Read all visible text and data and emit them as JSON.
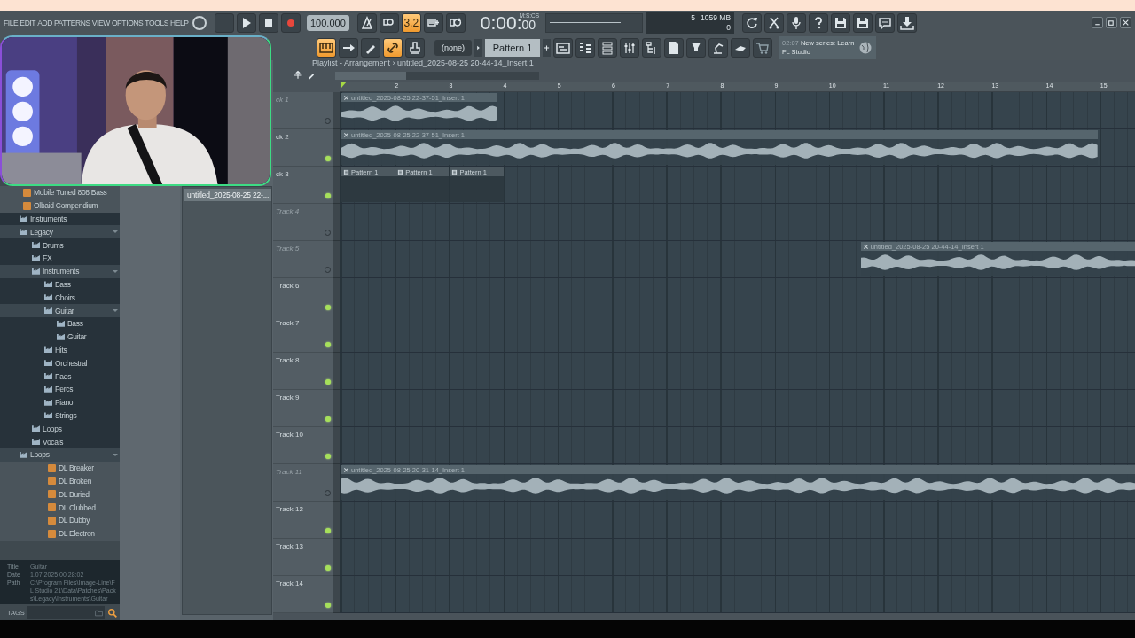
{
  "menu": [
    "FILE",
    "EDIT",
    "ADD",
    "PATTERNS",
    "VIEW",
    "OPTIONS",
    "TOOLS",
    "HELP"
  ],
  "transport": {
    "tempo": "100.000",
    "time": "0:00:",
    "time_cs": "00",
    "time_unit": "M:S:CS"
  },
  "toolbar_top": [
    {
      "on": false
    },
    {
      "on": false
    },
    {
      "on": true,
      "label": "3.2"
    },
    {
      "on": false
    },
    {
      "on": false
    }
  ],
  "monitor": {
    "voices": "5",
    "memory": "1059 MB",
    "cpu": "0"
  },
  "toolbar_second": [
    {
      "on": true
    },
    {
      "on": false
    },
    {
      "on": false
    },
    {
      "on": true
    },
    {
      "on": false
    }
  ],
  "pattern": {
    "channel": "(none)",
    "name": "Pattern 1"
  },
  "news": {
    "time": "02:07",
    "text": "New series: Learn FL Studio"
  },
  "browser": {
    "items": [
      {
        "label": "Mobile Tuned 808 Bass",
        "kind": "preset",
        "expanded": false
      },
      {
        "label": "Olbaid Compendium",
        "kind": "preset",
        "expanded": false
      },
      {
        "label": "Instruments",
        "kind": "folder",
        "expanded": false
      },
      {
        "label": "Legacy",
        "kind": "folder",
        "expanded": true,
        "children": [
          {
            "label": "Drums",
            "kind": "folder",
            "expanded": false
          },
          {
            "label": "FX",
            "kind": "folder",
            "expanded": false
          },
          {
            "label": "Instruments",
            "kind": "folder",
            "expanded": true,
            "children": [
              {
                "label": "Bass",
                "kind": "folder",
                "expanded": false
              },
              {
                "label": "Choirs",
                "kind": "folder",
                "expanded": false
              },
              {
                "label": "Guitar",
                "kind": "folder",
                "expanded": true,
                "children": [
                  {
                    "label": "Bass",
                    "kind": "folder",
                    "expanded": false
                  },
                  {
                    "label": "Guitar",
                    "kind": "folder",
                    "expanded": false
                  }
                ]
              },
              {
                "label": "Hits",
                "kind": "folder",
                "expanded": false
              },
              {
                "label": "Orchestral",
                "kind": "folder",
                "expanded": false
              },
              {
                "label": "Pads",
                "kind": "folder",
                "expanded": false
              },
              {
                "label": "Percs",
                "kind": "folder",
                "expanded": false
              },
              {
                "label": "Piano",
                "kind": "folder",
                "expanded": false
              },
              {
                "label": "Strings",
                "kind": "folder",
                "expanded": false
              }
            ]
          },
          {
            "label": "Loops",
            "kind": "folder",
            "expanded": false
          },
          {
            "label": "Vocals",
            "kind": "folder",
            "expanded": false
          }
        ]
      },
      {
        "label": "Loops",
        "kind": "folder",
        "expanded": true,
        "children": [
          {
            "label": "DL Breaker",
            "kind": "loop",
            "expanded": false
          },
          {
            "label": "DL Broken",
            "kind": "loop",
            "expanded": false
          },
          {
            "label": "DL Buried",
            "kind": "loop",
            "expanded": false
          },
          {
            "label": "DL Clubbed",
            "kind": "loop",
            "expanded": false
          },
          {
            "label": "DL Dubby",
            "kind": "loop",
            "expanded": false
          },
          {
            "label": "DL Electron",
            "kind": "loop",
            "expanded": false
          }
        ]
      }
    ],
    "info": [
      {
        "label": "Title",
        "value": "Guitar"
      },
      {
        "label": "Date",
        "value": "1.07.2025 00:28:02"
      },
      {
        "label": "Path",
        "value": "C:\\Program Files\\Image-Line\\FL Studio 21\\Data\\Patches\\Packs\\Legacy\\Instruments\\Guitar"
      }
    ],
    "tags_label": "TAGS"
  },
  "picker": {
    "items": [
      "untitled_2025-08-25 22-..."
    ]
  },
  "playlist": {
    "breadcrumb": "Playlist - Arrangement › untitled_2025-08-25 20-44-14_Insert 1",
    "bars": [
      "2",
      "3",
      "4",
      "5",
      "6",
      "7",
      "8",
      "9",
      "10",
      "11",
      "12",
      "13",
      "14",
      "15"
    ],
    "tracks": [
      {
        "name": "ck 1",
        "enabled": false,
        "clips": [
          {
            "kind": "audio",
            "label": "untitled_2025-08-25 22-37-51_Insert 1"
          }
        ]
      },
      {
        "name": "ck 2",
        "enabled": true,
        "clips": [
          {
            "kind": "audio",
            "label": "untitled_2025-08-25 22-37-51_Insert 1"
          }
        ]
      },
      {
        "name": "ck 3",
        "enabled": true,
        "clips": [
          {
            "kind": "pattern",
            "label": "Pattern 1"
          },
          {
            "kind": "pattern",
            "label": "Pattern 1"
          },
          {
            "kind": "pattern",
            "label": "Pattern 1"
          }
        ]
      },
      {
        "name": "Track 4",
        "enabled": false
      },
      {
        "name": "Track 5",
        "enabled": false,
        "clips": [
          {
            "kind": "audio",
            "label": "untitled_2025-08-25 20-44-14_Insert 1"
          }
        ]
      },
      {
        "name": "Track 6",
        "enabled": true
      },
      {
        "name": "Track 7",
        "enabled": true
      },
      {
        "name": "Track 8",
        "enabled": true
      },
      {
        "name": "Track 9",
        "enabled": true
      },
      {
        "name": "Track 10",
        "enabled": true
      },
      {
        "name": "Track 11",
        "enabled": false,
        "clips": [
          {
            "kind": "audio",
            "label": "untitled_2025-08-25 20-31-14_Insert 1"
          }
        ]
      },
      {
        "name": "Track 12",
        "enabled": true
      },
      {
        "name": "Track 13",
        "enabled": true
      },
      {
        "name": "Track 14",
        "enabled": true
      }
    ]
  }
}
